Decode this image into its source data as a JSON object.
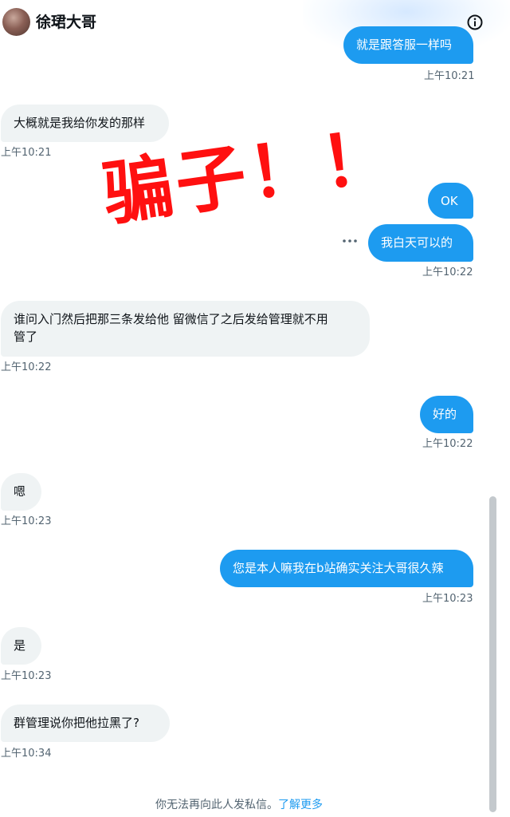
{
  "header": {
    "title": "徐珺大哥",
    "info_icon": "info-icon",
    "avatar_icon": "avatar"
  },
  "messages": [
    {
      "dir": "out",
      "text": "就是跟答服一样吗",
      "time": "上午10:21"
    },
    {
      "dir": "in",
      "text": "大概就是我给你发的那样",
      "time": "上午10:21"
    },
    {
      "dir": "out",
      "text": "OK",
      "time": ""
    },
    {
      "dir": "out",
      "text": "我白天可以的",
      "time": "上午10:22"
    },
    {
      "dir": "in",
      "text_line1": "谁问入门然后把那三条发给他 留微信了之后发给管理就不用",
      "text_line2": "管了",
      "time": "上午10:22"
    },
    {
      "dir": "out",
      "text": "好的",
      "time": "上午10:22"
    },
    {
      "dir": "in",
      "text": "嗯",
      "time": "上午10:23"
    },
    {
      "dir": "out",
      "text": "您是本人嘛我在b站确实关注大哥很久辣",
      "time": "上午10:23"
    },
    {
      "dir": "in",
      "text": "是",
      "time": "上午10:23"
    },
    {
      "dir": "in",
      "text": "群管理说你把他拉黑了?",
      "time": "上午10:34"
    }
  ],
  "overlay_stamp": "骗子！！",
  "footer": {
    "text": "你无法再向此人发私信。",
    "link": "了解更多"
  },
  "colors": {
    "outgoing_bubble": "#1d9bf0",
    "incoming_bubble": "#eff3f4",
    "stamp_red": "#ff1010",
    "timestamp": "#536471"
  }
}
